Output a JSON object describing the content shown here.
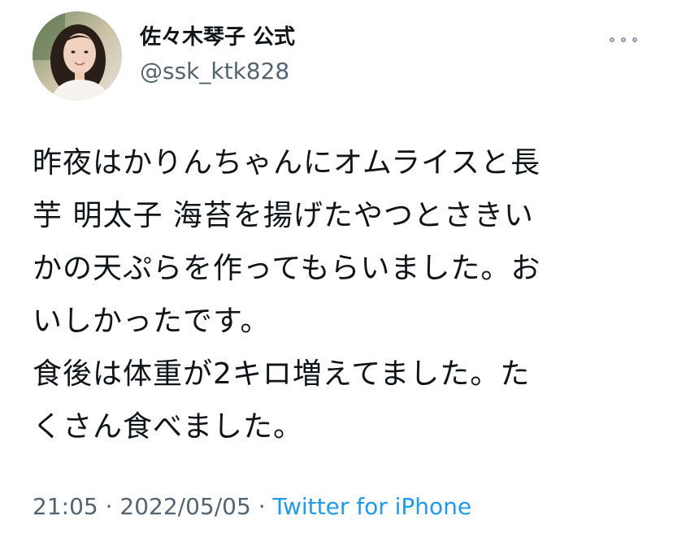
{
  "user": {
    "display_name": "佐々木琴子 公式",
    "handle": "@ssk_ktk828"
  },
  "tweet": {
    "lines": [
      "昨夜はかりんちゃんにオムライスと長",
      "芋 明太子 海苔を揚げたやつとさきい",
      "かの天ぷらを作ってもらいました。お",
      "いしかったです。",
      "食後は体重が2キロ増えてました。た",
      "くさん食べました。"
    ]
  },
  "meta": {
    "time": "21:05",
    "separator": " · ",
    "date": "2022/05/05",
    "source": "Twitter for iPhone"
  },
  "colors": {
    "text": "#0f1419",
    "secondary": "#536471",
    "link": "#1d9bf0"
  },
  "icons": {
    "more": "more-horizontal-icon"
  }
}
